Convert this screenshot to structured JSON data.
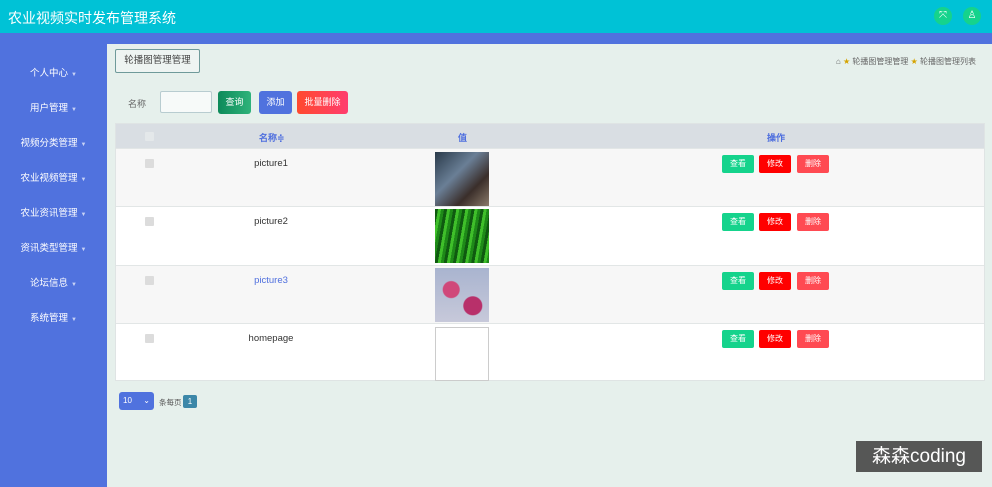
{
  "app": {
    "title": "农业视频实时发布管理系统"
  },
  "header_icons": [
    "fullscreen-icon",
    "user-icon"
  ],
  "sidebar": {
    "items": [
      {
        "label": "个人中心"
      },
      {
        "label": "用户管理"
      },
      {
        "label": "视频分类管理"
      },
      {
        "label": "农业视频管理"
      },
      {
        "label": "农业资讯管理"
      },
      {
        "label": "资讯类型管理"
      },
      {
        "label": "论坛信息"
      },
      {
        "label": "系统管理"
      }
    ]
  },
  "tab": {
    "label": "轮播图管理管理"
  },
  "breadcrumb": {
    "items": [
      "轮播图管理管理",
      "轮播图管理列表"
    ]
  },
  "search": {
    "label": "名称",
    "value": "",
    "query": "查询",
    "add": "添加",
    "batch_delete": "批量删除"
  },
  "table": {
    "headers": {
      "name": "名称≑",
      "value": "值",
      "actions": "操作"
    },
    "rows": [
      {
        "name": "picture1"
      },
      {
        "name": "picture2"
      },
      {
        "name": "picture3"
      },
      {
        "name": "homepage"
      }
    ],
    "actions": {
      "view": "查看",
      "edit": "修改",
      "delete": "删除"
    }
  },
  "pagination": {
    "page_size": "10",
    "per_page_label": "条每页",
    "current_page": "1"
  },
  "watermark": "森森coding",
  "colors": {
    "header": "#00c2d6",
    "sidebar": "#5072de",
    "view": "#15d38c",
    "edit": "#ff0000",
    "delete": "#ff4a52"
  }
}
